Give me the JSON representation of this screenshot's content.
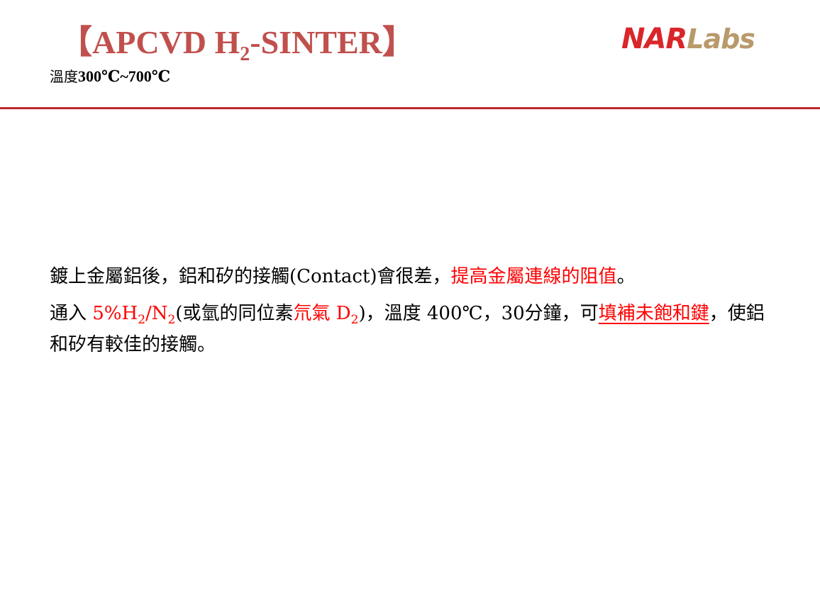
{
  "header": {
    "title_prefix": "【APCVD H",
    "title_sub": "2",
    "title_suffix": "-SINTER】",
    "subtitle_label": "溫度",
    "subtitle_range": "300℃~700℃"
  },
  "logo": {
    "part1": "NAR",
    "part2": "Labs"
  },
  "colors": {
    "title": "#c0504d",
    "rule": "#c0282d",
    "highlight": "#ff0000",
    "logo_red": "#d9262a",
    "logo_gold": "#b89a6a"
  },
  "paragraph1": {
    "text": "鍍上金屬鋁後，鋁和矽的接觸(Contact)會很差，",
    "highlight": "提高金屬連線的阻值",
    "end": "。"
  },
  "paragraph2": {
    "lead": "通入 ",
    "gas_pct": "5%H",
    "gas_sub1": "2",
    "gas_slash": "/N",
    "gas_sub2": "2",
    "paren_open": "(或氫的同位素",
    "deuterium": "氘氣 D",
    "deuterium_sub": "2",
    "paren_close": ")，溫度 400℃，30分鐘，可",
    "effect": "填補未飽和鍵",
    "tail": "，使鋁和矽有較佳的接觸。"
  }
}
